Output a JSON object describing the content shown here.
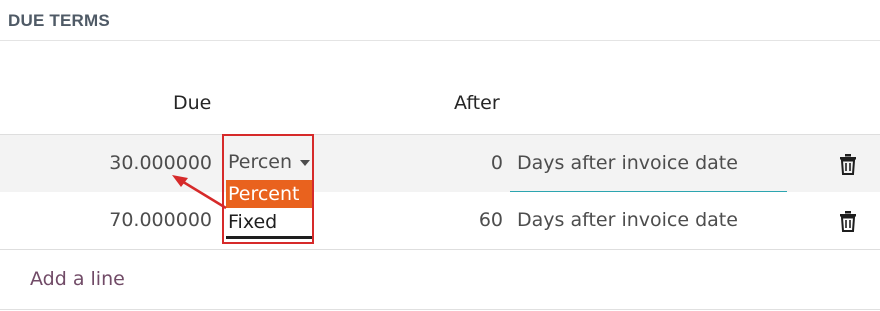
{
  "section": {
    "title": "DUE TERMS"
  },
  "columns": {
    "due": "Due",
    "after": "After"
  },
  "rows": [
    {
      "value": "30.000000",
      "type": "Percen",
      "days": "0",
      "delay": "Days after invoice date"
    },
    {
      "value": "70.000000",
      "days": "60",
      "delay": "Days after invoice date"
    }
  ],
  "dropdown": {
    "options": [
      {
        "label": "Percent",
        "highlighted": true
      },
      {
        "label": "Fixed",
        "highlighted": false
      }
    ]
  },
  "actions": {
    "add_line": "Add a line"
  },
  "colors": {
    "accent": "#714b67",
    "highlight_option": "#e9621e",
    "annotation_red": "#d62a2a",
    "focus_underline": "#2ca5b0"
  },
  "icons": {
    "delete": "trash-icon"
  }
}
